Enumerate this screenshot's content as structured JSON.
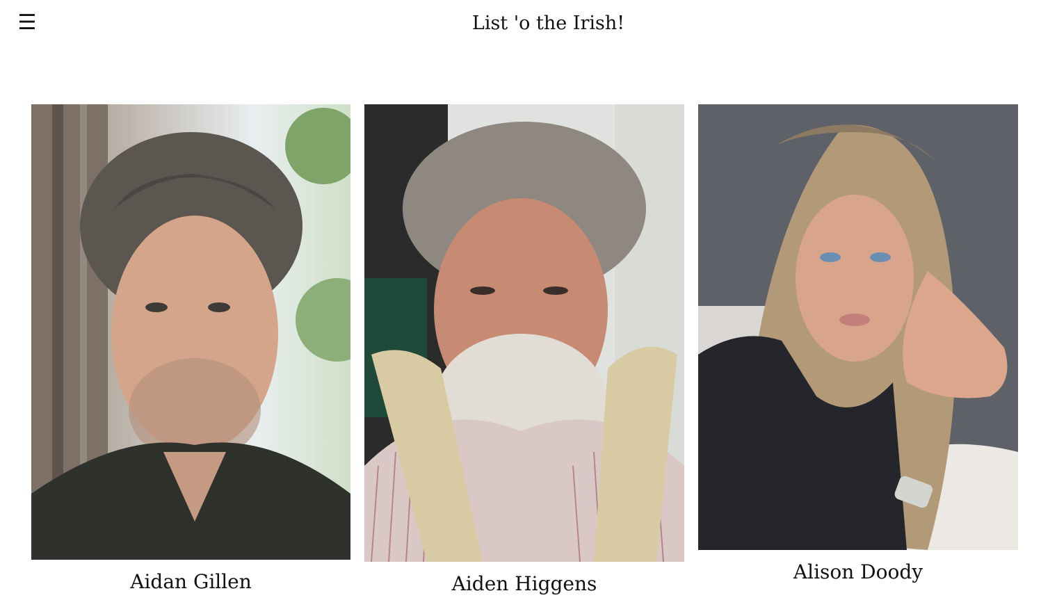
{
  "header": {
    "menu_icon": "hamburger-menu-icon",
    "menu_glyph": "☰",
    "title": "List 'o the Irish!"
  },
  "people": [
    {
      "name": "Aidan Gillen",
      "photo": "portrait of a man with tousled grey hair and stubble in a dark shirt, tree behind"
    },
    {
      "name": "Aiden Higgens",
      "photo": "portrait of an older man with grey hair and white beard, striped shirt and towel over shoulders"
    },
    {
      "name": "Alison Doody",
      "photo": "portrait of a woman with long blonde wavy hair, dark sleeveless top, leaning on white sofa"
    }
  ]
}
